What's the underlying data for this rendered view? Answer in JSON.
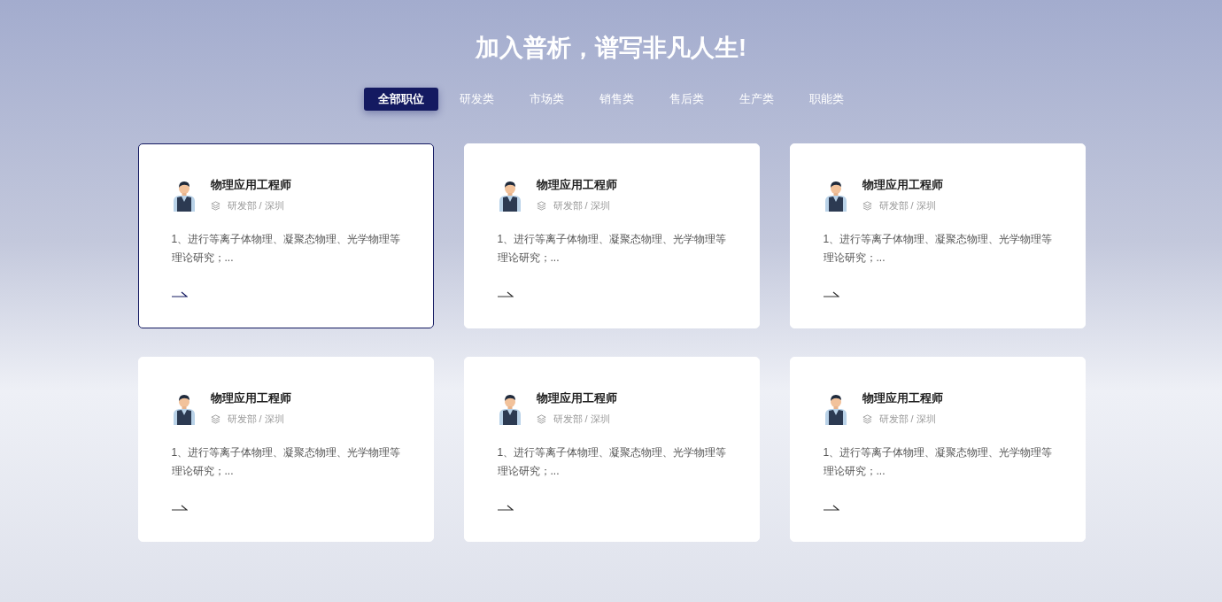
{
  "heading": "加入普析，谱写非凡人生!",
  "tabs": [
    {
      "label": "全部职位",
      "selected": true
    },
    {
      "label": "研发类",
      "selected": false
    },
    {
      "label": "市场类",
      "selected": false
    },
    {
      "label": "销售类",
      "selected": false
    },
    {
      "label": "售后类",
      "selected": false
    },
    {
      "label": "生产类",
      "selected": false
    },
    {
      "label": "职能类",
      "selected": false
    }
  ],
  "jobs": [
    {
      "title": "物理应用工程师",
      "meta": "研发部 / 深圳",
      "description": "1、进行等离子体物理、凝聚态物理、光学物理等理论研究；...",
      "selected": true
    },
    {
      "title": "物理应用工程师",
      "meta": "研发部 / 深圳",
      "description": "1、进行等离子体物理、凝聚态物理、光学物理等理论研究；...",
      "selected": false
    },
    {
      "title": "物理应用工程师",
      "meta": "研发部 / 深圳",
      "description": "1、进行等离子体物理、凝聚态物理、光学物理等理论研究；...",
      "selected": false
    },
    {
      "title": "物理应用工程师",
      "meta": "研发部 / 深圳",
      "description": "1、进行等离子体物理、凝聚态物理、光学物理等理论研究；...",
      "selected": false
    },
    {
      "title": "物理应用工程师",
      "meta": "研发部 / 深圳",
      "description": "1、进行等离子体物理、凝聚态物理、光学物理等理论研究；...",
      "selected": false
    },
    {
      "title": "物理应用工程师",
      "meta": "研发部 / 深圳",
      "description": "1、进行等离子体物理、凝聚态物理、光学物理等理论研究；...",
      "selected": false
    }
  ]
}
